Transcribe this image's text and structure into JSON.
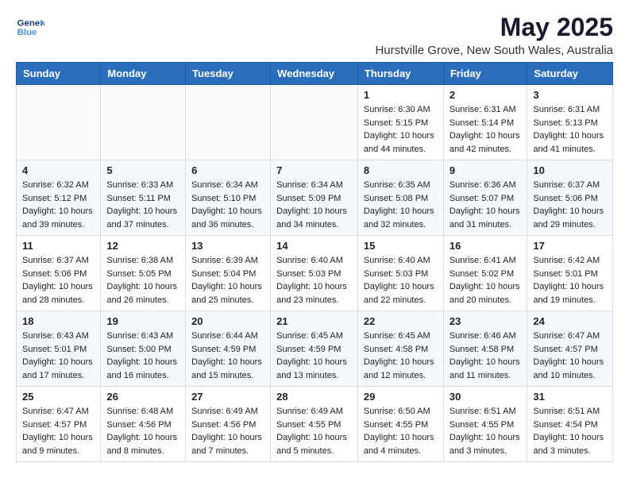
{
  "header": {
    "logo_line1": "General",
    "logo_line2": "Blue",
    "title": "May 2025",
    "subtitle": "Hurstville Grove, New South Wales, Australia"
  },
  "days_of_week": [
    "Sunday",
    "Monday",
    "Tuesday",
    "Wednesday",
    "Thursday",
    "Friday",
    "Saturday"
  ],
  "weeks": [
    [
      {
        "day": "",
        "sunrise": "",
        "sunset": "",
        "daylight": ""
      },
      {
        "day": "",
        "sunrise": "",
        "sunset": "",
        "daylight": ""
      },
      {
        "day": "",
        "sunrise": "",
        "sunset": "",
        "daylight": ""
      },
      {
        "day": "",
        "sunrise": "",
        "sunset": "",
        "daylight": ""
      },
      {
        "day": "1",
        "sunrise": "Sunrise: 6:30 AM",
        "sunset": "Sunset: 5:15 PM",
        "daylight": "Daylight: 10 hours and 44 minutes."
      },
      {
        "day": "2",
        "sunrise": "Sunrise: 6:31 AM",
        "sunset": "Sunset: 5:14 PM",
        "daylight": "Daylight: 10 hours and 42 minutes."
      },
      {
        "day": "3",
        "sunrise": "Sunrise: 6:31 AM",
        "sunset": "Sunset: 5:13 PM",
        "daylight": "Daylight: 10 hours and 41 minutes."
      }
    ],
    [
      {
        "day": "4",
        "sunrise": "Sunrise: 6:32 AM",
        "sunset": "Sunset: 5:12 PM",
        "daylight": "Daylight: 10 hours and 39 minutes."
      },
      {
        "day": "5",
        "sunrise": "Sunrise: 6:33 AM",
        "sunset": "Sunset: 5:11 PM",
        "daylight": "Daylight: 10 hours and 37 minutes."
      },
      {
        "day": "6",
        "sunrise": "Sunrise: 6:34 AM",
        "sunset": "Sunset: 5:10 PM",
        "daylight": "Daylight: 10 hours and 36 minutes."
      },
      {
        "day": "7",
        "sunrise": "Sunrise: 6:34 AM",
        "sunset": "Sunset: 5:09 PM",
        "daylight": "Daylight: 10 hours and 34 minutes."
      },
      {
        "day": "8",
        "sunrise": "Sunrise: 6:35 AM",
        "sunset": "Sunset: 5:08 PM",
        "daylight": "Daylight: 10 hours and 32 minutes."
      },
      {
        "day": "9",
        "sunrise": "Sunrise: 6:36 AM",
        "sunset": "Sunset: 5:07 PM",
        "daylight": "Daylight: 10 hours and 31 minutes."
      },
      {
        "day": "10",
        "sunrise": "Sunrise: 6:37 AM",
        "sunset": "Sunset: 5:06 PM",
        "daylight": "Daylight: 10 hours and 29 minutes."
      }
    ],
    [
      {
        "day": "11",
        "sunrise": "Sunrise: 6:37 AM",
        "sunset": "Sunset: 5:06 PM",
        "daylight": "Daylight: 10 hours and 28 minutes."
      },
      {
        "day": "12",
        "sunrise": "Sunrise: 6:38 AM",
        "sunset": "Sunset: 5:05 PM",
        "daylight": "Daylight: 10 hours and 26 minutes."
      },
      {
        "day": "13",
        "sunrise": "Sunrise: 6:39 AM",
        "sunset": "Sunset: 5:04 PM",
        "daylight": "Daylight: 10 hours and 25 minutes."
      },
      {
        "day": "14",
        "sunrise": "Sunrise: 6:40 AM",
        "sunset": "Sunset: 5:03 PM",
        "daylight": "Daylight: 10 hours and 23 minutes."
      },
      {
        "day": "15",
        "sunrise": "Sunrise: 6:40 AM",
        "sunset": "Sunset: 5:03 PM",
        "daylight": "Daylight: 10 hours and 22 minutes."
      },
      {
        "day": "16",
        "sunrise": "Sunrise: 6:41 AM",
        "sunset": "Sunset: 5:02 PM",
        "daylight": "Daylight: 10 hours and 20 minutes."
      },
      {
        "day": "17",
        "sunrise": "Sunrise: 6:42 AM",
        "sunset": "Sunset: 5:01 PM",
        "daylight": "Daylight: 10 hours and 19 minutes."
      }
    ],
    [
      {
        "day": "18",
        "sunrise": "Sunrise: 6:43 AM",
        "sunset": "Sunset: 5:01 PM",
        "daylight": "Daylight: 10 hours and 17 minutes."
      },
      {
        "day": "19",
        "sunrise": "Sunrise: 6:43 AM",
        "sunset": "Sunset: 5:00 PM",
        "daylight": "Daylight: 10 hours and 16 minutes."
      },
      {
        "day": "20",
        "sunrise": "Sunrise: 6:44 AM",
        "sunset": "Sunset: 4:59 PM",
        "daylight": "Daylight: 10 hours and 15 minutes."
      },
      {
        "day": "21",
        "sunrise": "Sunrise: 6:45 AM",
        "sunset": "Sunset: 4:59 PM",
        "daylight": "Daylight: 10 hours and 13 minutes."
      },
      {
        "day": "22",
        "sunrise": "Sunrise: 6:45 AM",
        "sunset": "Sunset: 4:58 PM",
        "daylight": "Daylight: 10 hours and 12 minutes."
      },
      {
        "day": "23",
        "sunrise": "Sunrise: 6:46 AM",
        "sunset": "Sunset: 4:58 PM",
        "daylight": "Daylight: 10 hours and 11 minutes."
      },
      {
        "day": "24",
        "sunrise": "Sunrise: 6:47 AM",
        "sunset": "Sunset: 4:57 PM",
        "daylight": "Daylight: 10 hours and 10 minutes."
      }
    ],
    [
      {
        "day": "25",
        "sunrise": "Sunrise: 6:47 AM",
        "sunset": "Sunset: 4:57 PM",
        "daylight": "Daylight: 10 hours and 9 minutes."
      },
      {
        "day": "26",
        "sunrise": "Sunrise: 6:48 AM",
        "sunset": "Sunset: 4:56 PM",
        "daylight": "Daylight: 10 hours and 8 minutes."
      },
      {
        "day": "27",
        "sunrise": "Sunrise: 6:49 AM",
        "sunset": "Sunset: 4:56 PM",
        "daylight": "Daylight: 10 hours and 7 minutes."
      },
      {
        "day": "28",
        "sunrise": "Sunrise: 6:49 AM",
        "sunset": "Sunset: 4:55 PM",
        "daylight": "Daylight: 10 hours and 5 minutes."
      },
      {
        "day": "29",
        "sunrise": "Sunrise: 6:50 AM",
        "sunset": "Sunset: 4:55 PM",
        "daylight": "Daylight: 10 hours and 4 minutes."
      },
      {
        "day": "30",
        "sunrise": "Sunrise: 6:51 AM",
        "sunset": "Sunset: 4:55 PM",
        "daylight": "Daylight: 10 hours and 3 minutes."
      },
      {
        "day": "31",
        "sunrise": "Sunrise: 6:51 AM",
        "sunset": "Sunset: 4:54 PM",
        "daylight": "Daylight: 10 hours and 3 minutes."
      }
    ]
  ]
}
